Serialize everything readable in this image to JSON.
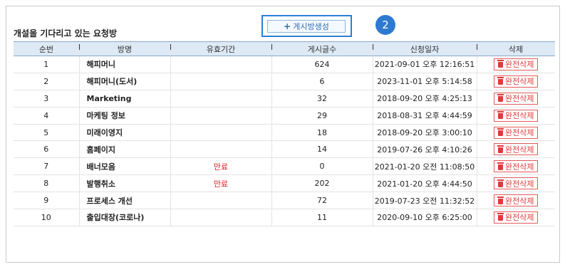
{
  "page": {
    "title": "개설을 기다리고 있는 요청방",
    "add_button_label": "게시방생성",
    "step_badge": "2"
  },
  "table": {
    "headers": [
      "순번",
      "방명",
      "유효기간",
      "게시글수",
      "신청일자",
      "삭제"
    ],
    "rows": [
      {
        "no": "1",
        "name": "해피머니",
        "validity": "",
        "posts": "624",
        "date": "2021-09-01 오후 12:16:51",
        "action": "완전삭제"
      },
      {
        "no": "2",
        "name": "해피머니(도서)",
        "validity": "",
        "posts": "6",
        "date": "2023-11-01 오후 5:14:58",
        "action": "완전삭제"
      },
      {
        "no": "3",
        "name": "Marketing",
        "validity": "",
        "posts": "32",
        "date": "2018-09-20 오후 4:25:13",
        "action": "완전삭제"
      },
      {
        "no": "4",
        "name": "마케팅 정보",
        "validity": "",
        "posts": "29",
        "date": "2018-08-31 오후 4:44:59",
        "action": "완전삭제"
      },
      {
        "no": "5",
        "name": "미래이영지",
        "validity": "",
        "posts": "18",
        "date": "2018-09-20 오후 3:00:10",
        "action": "완전삭제"
      },
      {
        "no": "6",
        "name": "홈페이지",
        "validity": "",
        "posts": "14",
        "date": "2019-07-26 오후 4:10:26",
        "action": "완전삭제"
      },
      {
        "no": "7",
        "name": "배너모음",
        "validity": "만료",
        "posts": "0",
        "date": "2021-01-20 오전 11:08:50",
        "action": "완전삭제"
      },
      {
        "no": "8",
        "name": "발행취소",
        "validity": "만료",
        "posts": "202",
        "date": "2021-01-20 오후 4:44:50",
        "action": "완전삭제"
      },
      {
        "no": "9",
        "name": "프로세스 개선",
        "validity": "",
        "posts": "72",
        "date": "2019-07-23 오전 11:32:52",
        "action": "완전삭제"
      },
      {
        "no": "10",
        "name": "출입대장(코로나)",
        "validity": "",
        "posts": "11",
        "date": "2020-09-10 오후 6:25:00",
        "action": "완전삭제"
      }
    ]
  },
  "colors": {
    "header_bg": "#dde9f5",
    "highlight_border": "#2d7fd3",
    "badge_bg": "#2e7ad1",
    "delete_red": "#e03a3a",
    "expired_red": "#e02020"
  }
}
